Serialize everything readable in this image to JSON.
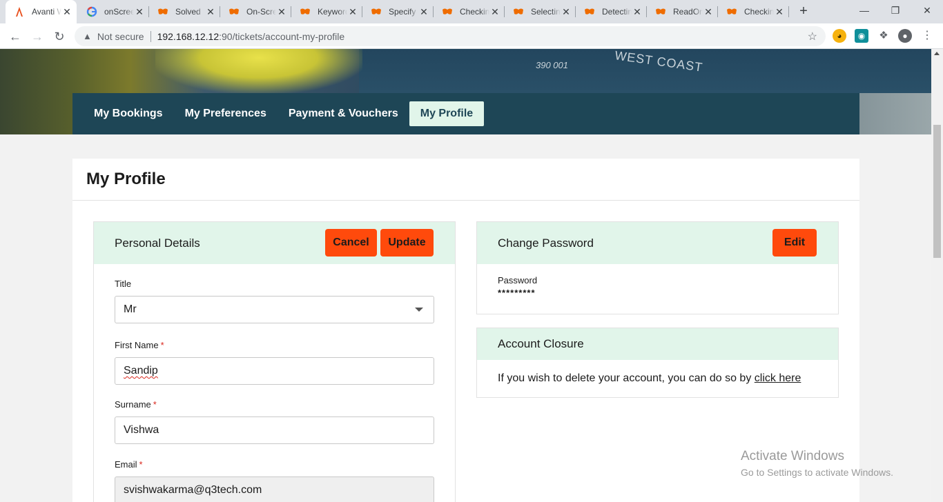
{
  "browser": {
    "tabs": [
      {
        "title": "Avanti West Coast",
        "favicon": "avanti-logo-icon",
        "active": true
      },
      {
        "title": "onScreen",
        "favicon": "google-icon"
      },
      {
        "title": "Solved",
        "favicon": "mask-icon"
      },
      {
        "title": "On-Screen",
        "favicon": "mask-icon"
      },
      {
        "title": "Keyword",
        "favicon": "mask-icon"
      },
      {
        "title": "Specify",
        "favicon": "mask-icon"
      },
      {
        "title": "Checking",
        "favicon": "mask-icon"
      },
      {
        "title": "Selecting",
        "favicon": "mask-icon"
      },
      {
        "title": "Detecting",
        "favicon": "mask-icon"
      },
      {
        "title": "ReadOnly",
        "favicon": "mask-icon"
      },
      {
        "title": "Checking",
        "favicon": "mask-icon"
      }
    ],
    "security_label": "Not secure",
    "url_host": "192.168.12.12",
    "url_rest": ":90/tickets/account-my-profile"
  },
  "hero": {
    "lettering": "WEST COAST",
    "number": "390 001"
  },
  "nav": {
    "items": [
      "My Bookings",
      "My Preferences",
      "Payment & Vouchers",
      "My Profile"
    ],
    "active": "My Profile"
  },
  "page": {
    "title": "My Profile"
  },
  "personal": {
    "heading": "Personal Details",
    "cancel_label": "Cancel",
    "update_label": "Update",
    "title_label": "Title",
    "title_value": "Mr",
    "first_name_label": "First Name",
    "first_name_value": "Sandip",
    "surname_label": "Surname",
    "surname_value": "Vishwa",
    "email_label": "Email",
    "email_value": "svishwakarma@q3tech.com",
    "required_marker": "*"
  },
  "password": {
    "heading": "Change Password",
    "edit_label": "Edit",
    "label": "Password",
    "value": "*********"
  },
  "closure": {
    "heading": "Account Closure",
    "text": "If you wish to delete your account, you can do so by",
    "link": "click here"
  },
  "watermark": {
    "line1": "Activate Windows",
    "line2": "Go to Settings to activate Windows."
  },
  "colors": {
    "accent": "#ff4a0c",
    "nav": "#1e4656",
    "panel_header": "#e1f5ea"
  }
}
